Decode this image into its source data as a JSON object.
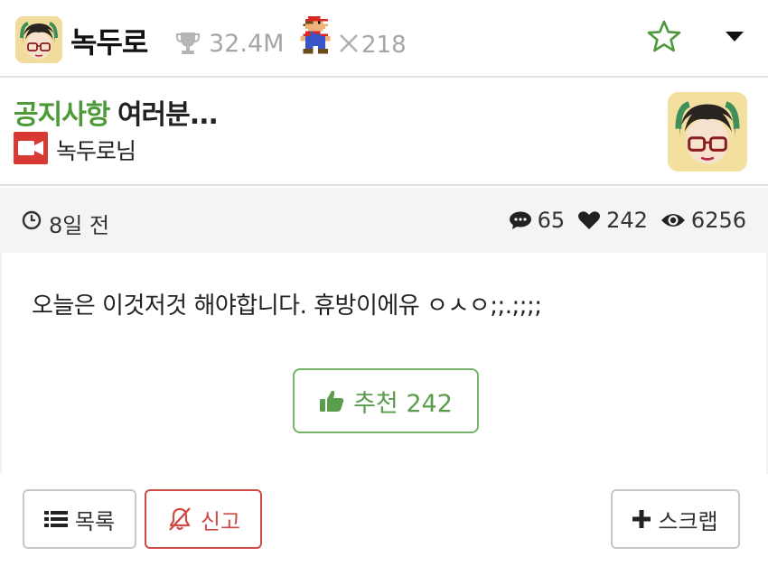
{
  "header": {
    "username": "녹두로",
    "points": "32.4M",
    "level": "218"
  },
  "post": {
    "category": "공지사항",
    "title": "여러분...",
    "author": "녹두로님",
    "time": "8일 전",
    "comments": "65",
    "likes": "242",
    "views": "6256",
    "body": "오늘은 이것저것 해야합니다. 휴방이에유 ㅇㅅㅇ;;.;;;;",
    "recommend_label": "추천 242"
  },
  "actions": {
    "list_label": "목록",
    "report_label": "신고",
    "scrap_label": "스크랩"
  },
  "colors": {
    "accent_green": "#4e9a3a",
    "report_red": "#cf4b45",
    "muted_gray": "#a6a6a6"
  },
  "icons": [
    "avatar",
    "trophy-icon",
    "mario-icon",
    "times-icon",
    "star-icon",
    "caret-down-icon",
    "video-camera-icon",
    "clock-icon",
    "comment-icon",
    "heart-icon",
    "eye-icon",
    "thumbs-up-icon",
    "list-icon",
    "bell-slash-icon",
    "plus-icon"
  ]
}
